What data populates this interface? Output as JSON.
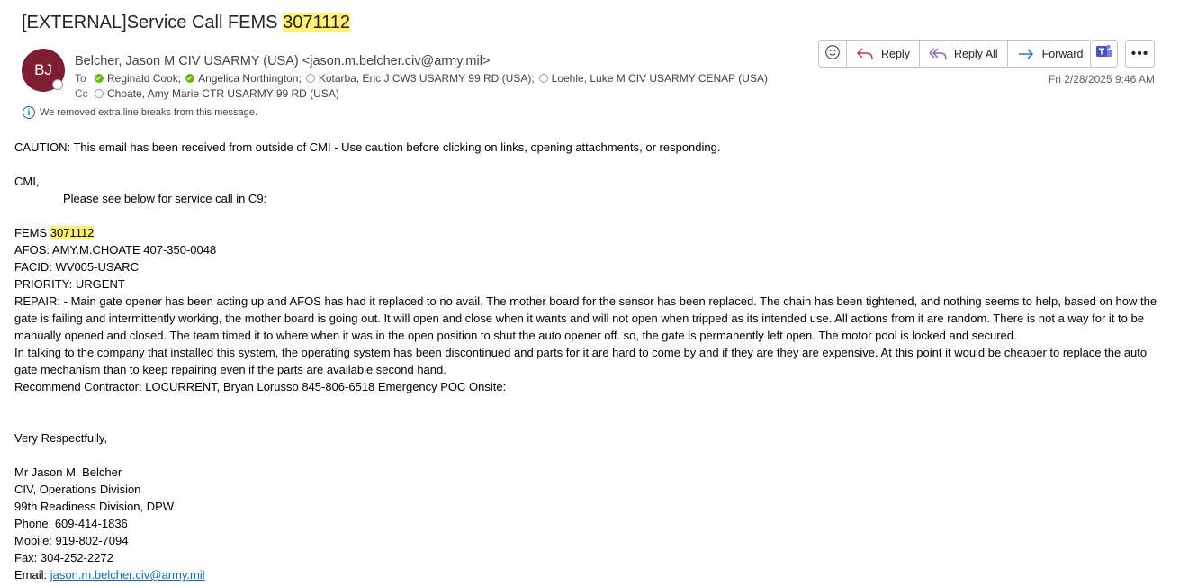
{
  "subject": {
    "prefix": "[EXTERNAL]Service Call FEMS ",
    "highlight": "3071112"
  },
  "sender": {
    "initials": "BJ",
    "display": "Belcher, Jason M CIV USARMY (USA) <jason.m.belcher.civ@army.mil>"
  },
  "to_label": "To",
  "to": [
    {
      "name": "Reginald Cook;",
      "status": "available"
    },
    {
      "name": "Angelica Northington;",
      "status": "available"
    },
    {
      "name": "Kotarba, Eric J CW3 USARMY 99 RD (USA);",
      "status": "offline"
    },
    {
      "name": "Loehle, Luke M CIV USARMY CENAP (USA)",
      "status": "offline"
    }
  ],
  "cc_label": "Cc",
  "cc": [
    {
      "name": "Choate, Amy Marie CTR USARMY 99 RD (USA)",
      "status": "offline"
    }
  ],
  "info_notice": "We removed extra line breaks from this message.",
  "actions": {
    "reply": "Reply",
    "reply_all": "Reply All",
    "forward": "Forward"
  },
  "date": "Fri 2/28/2025 9:46 AM",
  "accent_color": "#0f6cbd",
  "avatar_color": "#7f1d33",
  "body": {
    "caution": "CAUTION: This email has been received from outside of CMI - Use caution before clicking on links, opening attachments, or responding.",
    "greeting": "CMI,",
    "intro": "Please see below for service call in C9:",
    "fems_prefix": "FEMS ",
    "fems_number": "3071112",
    "afos": "AFOS: AMY.M.CHOATE 407-350-0048",
    "facid": "FACID: WV005-USARC",
    "priority": "PRIORITY: URGENT",
    "repair": "REPAIR: - Main gate opener has been acting up and AFOS has had it replaced to no avail. The mother board for the sensor has been replaced. The chain has been tightened, and nothing seems to help, based on how the gate is failing and intermittently working, the mother board is going out. It will open and close when it wants and will not open when tripped as its intended use. All actions from it are random. There is not a way for it to be manually opened and closed. The team timed it to where when it was in the open position to shut the auto opener off. so, the gate is permanently left open. The motor pool is locked and secured.",
    "company": "In talking to the company that installed this system, the operating system has been discontinued and parts for it are hard to come by and if they are they are expensive. At this point it would be cheaper to replace the auto gate mechanism than to keep repairing even if the parts are available second hand.",
    "recommend": "Recommend Contractor: LOCURRENT, Bryan Lorusso 845-806-6518 Emergency POC Onsite:",
    "closing": "Very Respectfully,",
    "sig_name": "Mr Jason M. Belcher",
    "sig_title": "CIV, Operations Division",
    "sig_org": "99th Readiness Division, DPW",
    "sig_phone": "Phone: 609-414-1836",
    "sig_mobile": "Mobile: 919-802-7094",
    "sig_fax": "Fax: 304-252-2272",
    "sig_email_label": "Email: ",
    "sig_email": "jason.m.belcher.civ@army.mil"
  }
}
